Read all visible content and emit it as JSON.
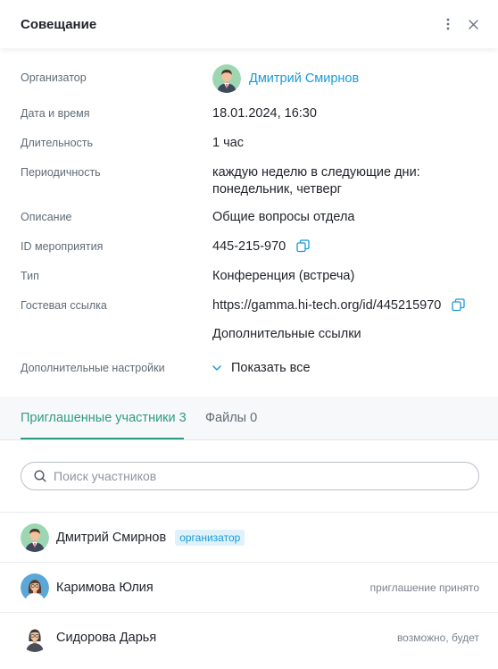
{
  "header": {
    "title": "Совещание"
  },
  "details": {
    "organizer": {
      "label": "Организатор",
      "name": "Дмитрий Смирнов"
    },
    "datetime": {
      "label": "Дата и время",
      "value": "18.01.2024, 16:30"
    },
    "duration": {
      "label": "Длительность",
      "value": "1 час"
    },
    "recurrence": {
      "label": "Периодичность",
      "line1": "каждую неделю в следующие дни:",
      "line2": "понедельник, четверг"
    },
    "description": {
      "label": "Описание",
      "value": "Общие вопросы отдела"
    },
    "event_id": {
      "label": "ID мероприятия",
      "value": "445-215-970"
    },
    "type": {
      "label": "Тип",
      "value": "Конференция (встреча)"
    },
    "guest_link": {
      "label": "Гостевая ссылка",
      "value": "https://gamma.hi-tech.org/id/445215970",
      "extra_links": "Дополнительные ссылки"
    },
    "advanced": {
      "label": "Дополнительные настройки",
      "show_all": "Показать все"
    }
  },
  "tabs": [
    {
      "label": "Приглашенные участники 3",
      "active": true
    },
    {
      "label": "Файлы 0",
      "active": false
    }
  ],
  "search": {
    "placeholder": "Поиск участников"
  },
  "participants": [
    {
      "name": "Дмитрий Смирнов",
      "badge": "организатор",
      "status": ""
    },
    {
      "name": "Каримова Юлия",
      "badge": "",
      "status": "приглашение принято"
    },
    {
      "name": "Сидорова Дарья",
      "badge": "",
      "status": "возможно, будет"
    }
  ],
  "colors": {
    "accent": "#1a9bd7",
    "tab_active": "#2e9b86",
    "label": "#5f6b76"
  }
}
